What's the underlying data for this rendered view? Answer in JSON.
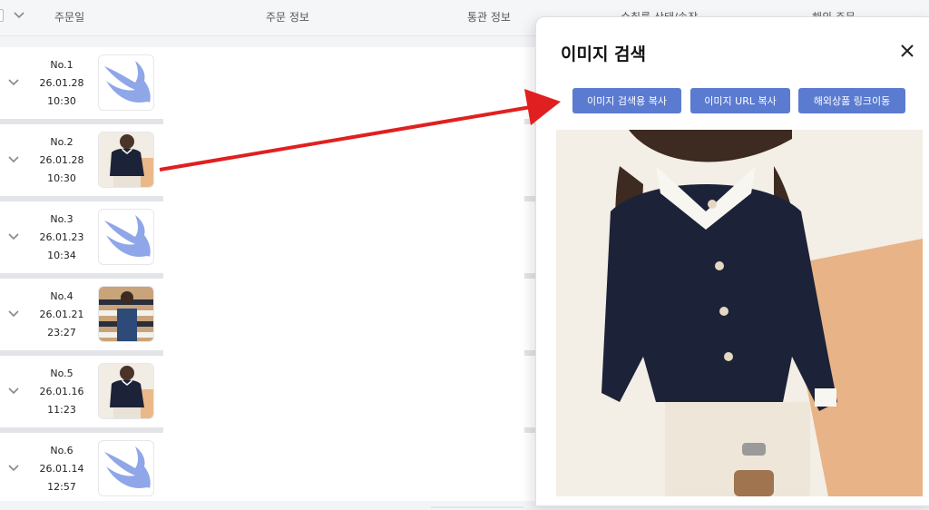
{
  "table": {
    "headers": {
      "order_date": "주문일",
      "order_info": "주문 정보",
      "customs_info": "통관 정보",
      "shipping_status": "수취를 상태/송장",
      "extra": "해외 주문"
    },
    "rows": [
      {
        "no": "No.1",
        "date": "26.01.28",
        "time": "10:30",
        "thumb": "swift-logo-icon"
      },
      {
        "no": "No.2",
        "date": "26.01.28",
        "time": "10:30",
        "thumb": "blouse-photo"
      },
      {
        "no": "No.3",
        "date": "26.01.23",
        "time": "10:34",
        "thumb": "swift-logo-icon"
      },
      {
        "no": "No.4",
        "date": "26.01.21",
        "time": "23:27",
        "thumb": "striped-shirt-photo"
      },
      {
        "no": "No.5",
        "date": "26.01.16",
        "time": "11:23",
        "thumb": "blouse-photo"
      },
      {
        "no": "No.6",
        "date": "26.01.14",
        "time": "12:57",
        "thumb": "swift-logo-icon"
      }
    ]
  },
  "dialog": {
    "title": "이미지 검색",
    "buttons": {
      "copy_for_search": "이미지 검색용 복사",
      "copy_url": "이미지 URL 복사",
      "overseas_link": "해외상품 링크이동"
    }
  },
  "colors": {
    "button": "#5b7bd0",
    "arrow": "#e02020",
    "swift_logo": "#8fa6e8",
    "blouse_navy": "#1c2238"
  }
}
